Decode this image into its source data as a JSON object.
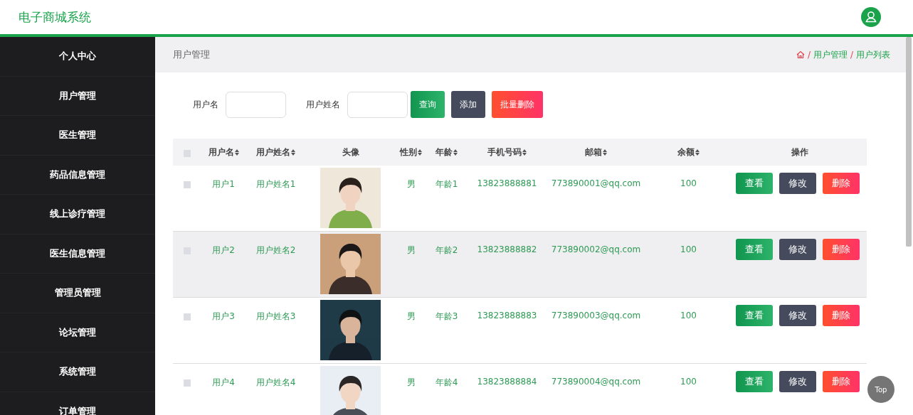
{
  "header": {
    "title": "电子商城系统"
  },
  "sidebar": {
    "items": [
      {
        "label": "个人中心"
      },
      {
        "label": "用户管理"
      },
      {
        "label": "医生管理"
      },
      {
        "label": "药品信息管理"
      },
      {
        "label": "线上诊疗管理"
      },
      {
        "label": "医生信息管理"
      },
      {
        "label": "管理员管理"
      },
      {
        "label": "论坛管理"
      },
      {
        "label": "系统管理"
      },
      {
        "label": "订单管理"
      }
    ]
  },
  "page_title": "用户管理",
  "breadcrumb": [
    {
      "separator": "/",
      "label": "用户管理"
    },
    {
      "separator": "/",
      "label": "用户列表"
    }
  ],
  "search": {
    "fields": [
      {
        "label": "用户名"
      },
      {
        "label": "用户姓名"
      }
    ],
    "buttons": [
      {
        "label": "查询",
        "kind": "query"
      },
      {
        "label": "添加",
        "kind": "add"
      },
      {
        "label": "批量删除",
        "kind": "delete"
      }
    ]
  },
  "table": {
    "all_checked": false,
    "columns": [
      {
        "label": "用户名",
        "sortable": true
      },
      {
        "label": "用户姓名",
        "sortable": true
      },
      {
        "label": "头像",
        "sortable": false
      },
      {
        "label": "性别",
        "sortable": true
      },
      {
        "label": "年龄",
        "sortable": true
      },
      {
        "label": "手机号码",
        "sortable": true
      },
      {
        "label": "邮箱",
        "sortable": true
      },
      {
        "label": "余额",
        "sortable": true
      },
      {
        "label": "操作",
        "sortable": false
      }
    ],
    "rows": [
      {
        "checked": false,
        "hovered": false,
        "cells": [
          "用户1",
          "用户姓名1",
          "",
          "男",
          "年龄1",
          "13823888881",
          "773890001@qq.com",
          "100"
        ],
        "avatar": {
          "kind": "picture"
        },
        "actions": [
          "查看",
          "修改",
          "删除"
        ]
      },
      {
        "checked": false,
        "hovered": true,
        "cells": [
          "用户2",
          "用户姓名2",
          "",
          "男",
          "年龄2",
          "13823888882",
          "773890002@qq.com",
          "100"
        ],
        "avatar": {
          "kind": "picture"
        },
        "actions": [
          "查看",
          "修改",
          "删除"
        ]
      },
      {
        "checked": false,
        "hovered": false,
        "cells": [
          "用户3",
          "用户姓名3",
          "",
          "男",
          "年龄3",
          "13823888883",
          "773890003@qq.com",
          "100"
        ],
        "avatar": {
          "kind": "picture"
        },
        "actions": [
          "查看",
          "修改",
          "删除"
        ]
      },
      {
        "checked": false,
        "hovered": false,
        "cells": [
          "用户4",
          "用户姓名4",
          "",
          "男",
          "年龄4",
          "13823888884",
          "773890004@qq.com",
          "100"
        ],
        "avatar": {
          "kind": "picture"
        },
        "actions": [
          "查看",
          "修改",
          "删除"
        ]
      }
    ]
  },
  "top_button": "Top"
}
